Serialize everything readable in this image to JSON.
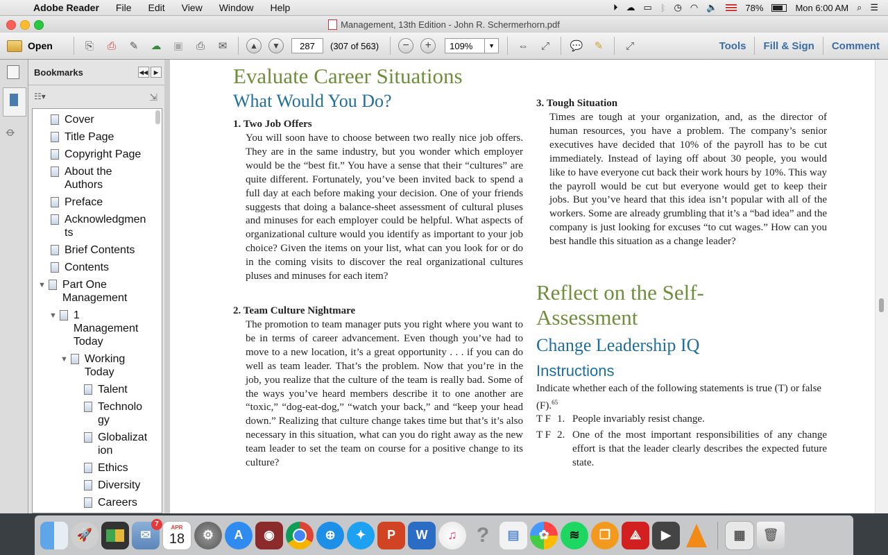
{
  "menubar": {
    "app": "Adobe Reader",
    "items": [
      "File",
      "Edit",
      "View",
      "Window",
      "Help"
    ],
    "battery": "78%",
    "clock": "Mon 6:00 AM"
  },
  "window": {
    "title": "Management, 13th Edition - John R. Schermerhorn.pdf"
  },
  "toolbar": {
    "open_label": "Open",
    "page_number": "287",
    "page_count": "(307 of 563)",
    "zoom": "109%",
    "tools": "Tools",
    "fill_sign": "Fill & Sign",
    "comment": "Comment"
  },
  "sidebar": {
    "title": "Bookmarks",
    "items": [
      {
        "label": "Cover",
        "level": 0
      },
      {
        "label": "Title Page",
        "level": 0
      },
      {
        "label": "Copyright Page",
        "level": 0
      },
      {
        "label": "About the Authors",
        "level": 0
      },
      {
        "label": "Preface",
        "level": 0
      },
      {
        "label": "Acknowledgments",
        "level": 0
      },
      {
        "label": "Brief Contents",
        "level": 0
      },
      {
        "label": "Contents",
        "level": 0
      },
      {
        "label": "Part One Management",
        "level": 0
      },
      {
        "label": "1 Management Today",
        "level": 1
      },
      {
        "label": "Working Today",
        "level": 2
      },
      {
        "label": "Talent",
        "level": 3
      },
      {
        "label": "Technology",
        "level": 3
      },
      {
        "label": "Globalization",
        "level": 3
      },
      {
        "label": "Ethics",
        "level": 3
      },
      {
        "label": "Diversity",
        "level": 3
      },
      {
        "label": "Careers",
        "level": 3
      }
    ]
  },
  "document": {
    "heading1": "Evaluate Career Situations",
    "heading2": "What Would You Do?",
    "item1_title": "1. Two Job Offers",
    "item1_body": "You will soon have to choose between two really nice job offers. They are in the same industry, but you wonder which employer would be the “best fit.” You have a sense that their “cultures” are quite different. Fortunately, you’ve been invited back to spend a full day at each before making your decision. One of your friends suggests that doing a balance-sheet assessment of cultural pluses and minuses for each employer could be helpful. What aspects of organizational culture would you identify as important to your job choice? Given the items on your list, what can you look for or do in the coming visits to discover the real organizational cultures pluses and minuses for each item?",
    "item2_title": "2. Team Culture Nightmare",
    "item2_body": "The promotion to team manager puts you right where you want to be in terms of career advancement. Even though you’ve had to move to a new location, it’s a great opportunity . . . if you can do well as team leader. That’s the problem. Now that you’re in the job, you realize that the culture of the team is really bad. Some of the ways you’ve heard members describe it to one another are “toxic,” “dog-eat-dog,” “watch your back,” and “keep your head down.” Realizing that culture change takes time but that’s it’s also necessary in this situation, what can you do right away as the new team leader to set the team on course for a positive change to its culture?",
    "item3_title": "3. Tough Situation",
    "item3_body": "Times are tough at your organization, and, as the director of human resources, you have a problem. The company’s senior executives have decided that 10% of the payroll has to be cut immediately. Instead of laying off about 30 people, you would like to have everyone cut back their work hours by 10%. This way the payroll would be cut but everyone would get to keep their jobs. But you’ve heard that this idea isn’t popular with all of the workers. Some are already grumbling that it’s a “bad idea” and the company is just looking for excuses “to cut wages.” How can you best handle this situation as a change leader?",
    "reflect_heading": "Reflect on the Self-Assessment",
    "iq_heading": "Change Leadership IQ",
    "instructions_heading": "Instructions",
    "instructions_body": "Indicate whether each of the following statements is true (T) or false (F).",
    "instructions_sup": "65",
    "statements": [
      {
        "tf": "T F",
        "num": "1.",
        "text": "People invariably resist change."
      },
      {
        "tf": "T F",
        "num": "2.",
        "text": "One of the most important responsibilities of any change effort is that the leader clearly describes the expected future state."
      }
    ]
  },
  "dock": {
    "calendar_month": "APR",
    "calendar_day": "18",
    "mail_badge": "7"
  },
  "colors": {
    "heading_green": "#6e8e3b",
    "heading_blue": "#1f6e9c",
    "toolbar_link": "#3b6da5"
  }
}
